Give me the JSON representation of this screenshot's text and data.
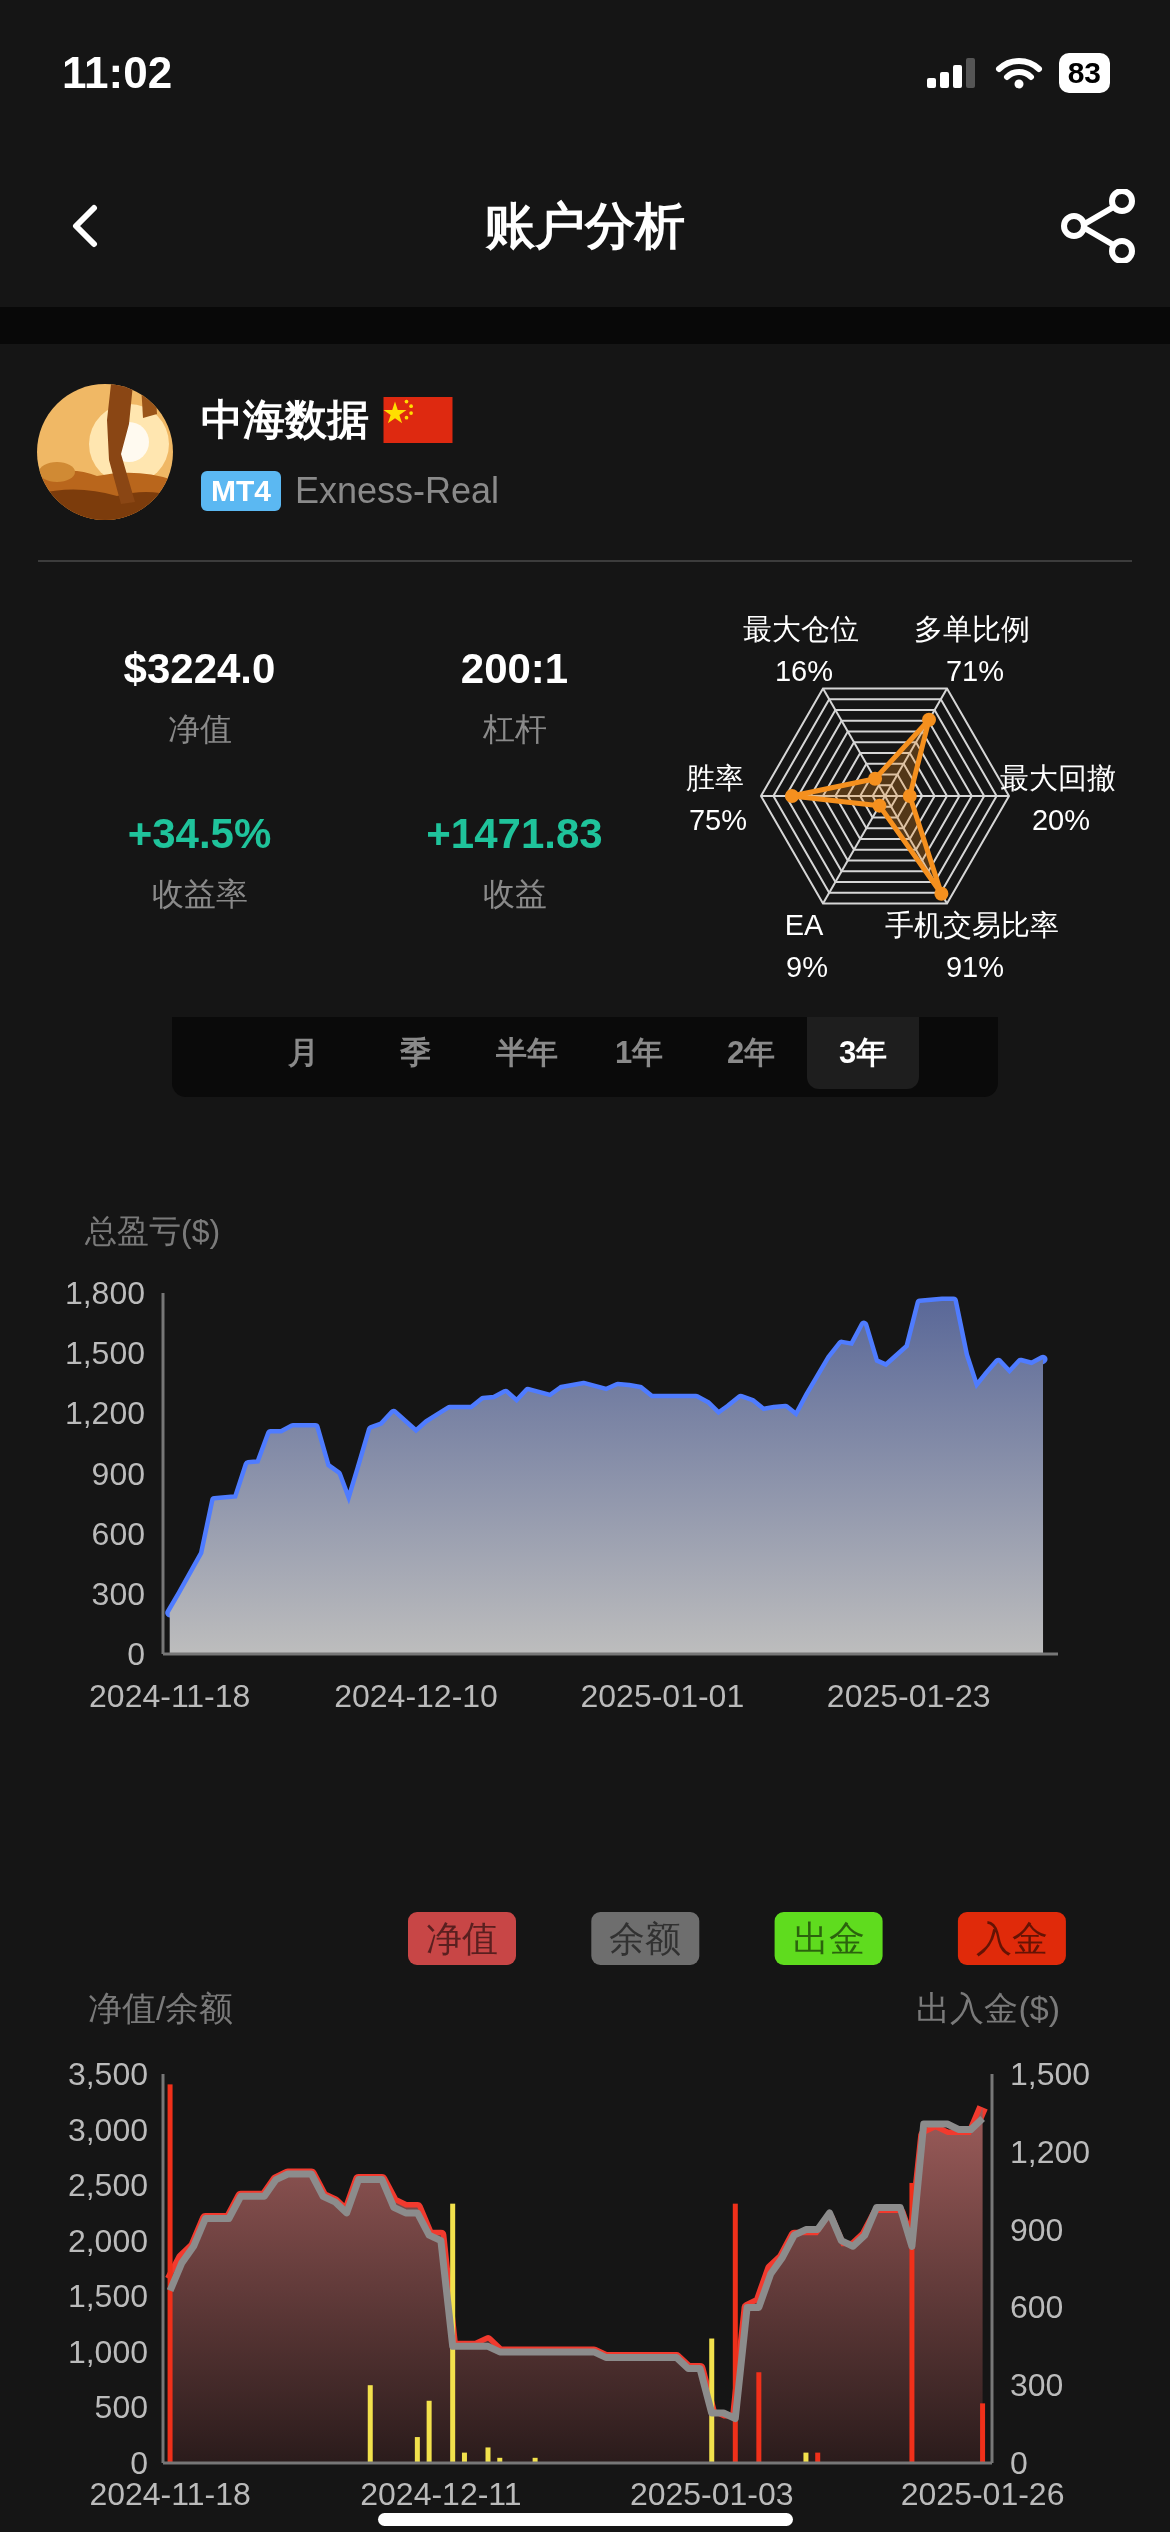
{
  "status_bar": {
    "time": "11:02",
    "battery": "83"
  },
  "nav": {
    "title": "账户分析"
  },
  "profile": {
    "name": "中海数据",
    "platform": "MT4",
    "server": "Exness-Real"
  },
  "stats": [
    {
      "value": "$3224.0",
      "label": "净值",
      "kind": "plain"
    },
    {
      "value": "200:1",
      "label": "杠杆",
      "kind": "plain"
    },
    {
      "value": "+34.5%",
      "label": "收益率",
      "kind": "gain"
    },
    {
      "value": "+1471.83",
      "label": "收益",
      "kind": "gain"
    }
  ],
  "radar": {
    "axes": [
      {
        "label": "最大仓位",
        "value": "16%"
      },
      {
        "label": "多单比例",
        "value": "71%"
      },
      {
        "label": "胜率",
        "value": "75%"
      },
      {
        "label": "最大回撤",
        "value": "20%"
      },
      {
        "label": "EA",
        "value": "9%"
      },
      {
        "label": "手机交易比率",
        "value": "91%"
      }
    ]
  },
  "periods": [
    {
      "label": "月",
      "selected": false
    },
    {
      "label": "季",
      "selected": false
    },
    {
      "label": "半年",
      "selected": false
    },
    {
      "label": "1年",
      "selected": false
    },
    {
      "label": "2年",
      "selected": false
    },
    {
      "label": "3年",
      "selected": true
    }
  ],
  "pnl_chart": {
    "chart_data": {
      "type": "area",
      "ylabel": "总盈亏($)",
      "categories": [
        "2024-11-18",
        null,
        null,
        null,
        null,
        null,
        null,
        null,
        null,
        null,
        null,
        null,
        null,
        null,
        null,
        null,
        null,
        null,
        null,
        null,
        null,
        null,
        "2024-12-10",
        null,
        null,
        null,
        null,
        null,
        null,
        null,
        null,
        null,
        null,
        null,
        null,
        null,
        null,
        null,
        null,
        null,
        null,
        null,
        null,
        null,
        "2025-01-01",
        null,
        null,
        null,
        null,
        null,
        null,
        null,
        null,
        null,
        null,
        null,
        null,
        null,
        null,
        null,
        null,
        null,
        null,
        null,
        null,
        null,
        "2025-01-23",
        null,
        null,
        null,
        null,
        null,
        null,
        null,
        null,
        null,
        null,
        null,
        null
      ],
      "series": [
        {
          "color": "#4f7cff",
          "values": [
            205,
            300,
            400,
            500,
            765,
            770,
            775,
            945,
            950,
            1100,
            1100,
            1130,
            1130,
            1130,
            935,
            895,
            745,
            930,
            1120,
            1140,
            1200,
            1150,
            1100,
            1150,
            1185,
            1220,
            1220,
            1220,
            1265,
            1270,
            1300,
            1250,
            1310,
            1295,
            1280,
            1320,
            1330,
            1340,
            1325,
            1310,
            1335,
            1330,
            1320,
            1275,
            1275,
            1275,
            1275,
            1275,
            1245,
            1190,
            1230,
            1275,
            1255,
            1210,
            1220,
            1225,
            1180,
            1285,
            1380,
            1475,
            1545,
            1535,
            1640,
            1455,
            1430,
            1480,
            1530,
            1750,
            1755,
            1760,
            1760,
            1490,
            1320,
            1390,
            1455,
            1395,
            1455,
            1440,
            1470
          ]
        }
      ],
      "ylim": [
        0,
        1800
      ],
      "yticks": [
        0,
        300,
        600,
        900,
        {
          "value": 1200,
          "label": "1,200"
        },
        {
          "value": 1500,
          "label": "1,500"
        },
        {
          "value": 1800,
          "label": "1,800"
        }
      ]
    }
  },
  "funds_chart": {
    "legend": [
      {
        "label": "净值",
        "color": "#c84646"
      },
      {
        "label": "余额",
        "color": "#6e6e6e"
      },
      {
        "label": "出金",
        "color": "#5fdc1e"
      },
      {
        "label": "入金",
        "color": "#e02a0a"
      }
    ],
    "chart_data": {
      "type": "line",
      "ylabel": "净值/余额",
      "y2label": "出入金($)",
      "categories": [
        "2024-11-18",
        null,
        null,
        null,
        null,
        null,
        null,
        null,
        null,
        null,
        null,
        null,
        null,
        null,
        null,
        null,
        null,
        null,
        null,
        null,
        null,
        null,
        null,
        "2024-12-11",
        null,
        null,
        null,
        null,
        null,
        null,
        null,
        null,
        null,
        null,
        null,
        null,
        null,
        null,
        null,
        null,
        null,
        null,
        null,
        null,
        null,
        null,
        "2025-01-03",
        null,
        null,
        null,
        null,
        null,
        null,
        null,
        null,
        null,
        null,
        null,
        null,
        null,
        null,
        null,
        null,
        null,
        null,
        null,
        null,
        null,
        null,
        "2025-01-26"
      ],
      "series": [
        {
          "color": "#f23a2e",
          "type": "area",
          "values": [
            1650,
            1850,
            1950,
            2200,
            2200,
            2200,
            2400,
            2400,
            2400,
            2550,
            2600,
            2600,
            2600,
            2400,
            2350,
            2250,
            2550,
            2550,
            2550,
            2350,
            2300,
            2300,
            2050,
            2050,
            1050,
            1050,
            1050,
            1100,
            1000,
            1000,
            1000,
            1000,
            1000,
            1000,
            1000,
            1000,
            1000,
            950,
            950,
            950,
            950,
            950,
            950,
            950,
            850,
            850,
            450,
            400,
            400,
            1400,
            1450,
            1750,
            1850,
            2050,
            2050,
            2050,
            2200,
            1950,
            1950,
            2050,
            2250,
            2250,
            2250,
            1950,
            2950,
            3000,
            2950,
            2950,
            2950,
            3200
          ]
        },
        {
          "color": "#8c8c8c",
          "values": [
            1550,
            1800,
            1950,
            2200,
            2200,
            2200,
            2400,
            2400,
            2400,
            2550,
            2600,
            2600,
            2600,
            2400,
            2350,
            2250,
            2550,
            2550,
            2550,
            2300,
            2250,
            2250,
            2050,
            2000,
            1050,
            1050,
            1050,
            1050,
            1000,
            1000,
            1000,
            1000,
            1000,
            1000,
            1000,
            1000,
            1000,
            950,
            950,
            950,
            950,
            950,
            950,
            950,
            850,
            850,
            450,
            450,
            400,
            1400,
            1400,
            1700,
            1850,
            2050,
            2100,
            2100,
            2250,
            2000,
            1950,
            2050,
            2300,
            2300,
            2300,
            1950,
            3050,
            3050,
            3050,
            3000,
            3000,
            3100
          ]
        },
        {
          "color": "#f2e14c",
          "type": "bar",
          "axis": "y2",
          "values": [
            null,
            null,
            null,
            null,
            null,
            null,
            null,
            null,
            null,
            null,
            null,
            null,
            null,
            null,
            null,
            null,
            null,
            300,
            null,
            null,
            null,
            100,
            240,
            null,
            1000,
            40,
            null,
            60,
            20,
            null,
            null,
            20,
            null,
            null,
            null,
            null,
            null,
            null,
            null,
            null,
            null,
            null,
            null,
            null,
            null,
            null,
            480,
            null,
            null,
            null,
            null,
            null,
            null,
            null,
            40,
            null,
            null,
            null,
            null,
            null,
            null,
            null,
            null,
            null,
            null,
            null,
            null,
            null,
            null,
            null
          ]
        },
        {
          "color": "#f0301a",
          "type": "bar",
          "axis": "y2",
          "values": [
            1460,
            null,
            null,
            null,
            null,
            null,
            null,
            null,
            null,
            null,
            null,
            null,
            null,
            null,
            null,
            null,
            null,
            null,
            null,
            null,
            null,
            null,
            null,
            null,
            null,
            null,
            null,
            null,
            null,
            null,
            null,
            null,
            null,
            null,
            null,
            null,
            null,
            null,
            null,
            null,
            null,
            null,
            null,
            null,
            null,
            null,
            null,
            null,
            1000,
            null,
            350,
            null,
            null,
            null,
            null,
            40,
            null,
            null,
            null,
            null,
            null,
            null,
            null,
            1080,
            null,
            null,
            null,
            null,
            null,
            230
          ]
        }
      ],
      "ylim": [
        0,
        3500
      ],
      "y2lim": [
        0,
        1500
      ],
      "yticks": [
        0,
        500,
        {
          "value": 1000,
          "label": "1,000"
        },
        {
          "value": 1500,
          "label": "1,500"
        },
        {
          "value": 2000,
          "label": "2,000"
        },
        {
          "value": 2500,
          "label": "2,500"
        },
        {
          "value": 3000,
          "label": "3,000"
        },
        {
          "value": 3500,
          "label": "3,500"
        }
      ],
      "y2ticks": [
        0,
        300,
        600,
        900,
        {
          "value": 1200,
          "label": "1,200"
        },
        {
          "value": 1500,
          "label": "1,500"
        }
      ]
    }
  }
}
